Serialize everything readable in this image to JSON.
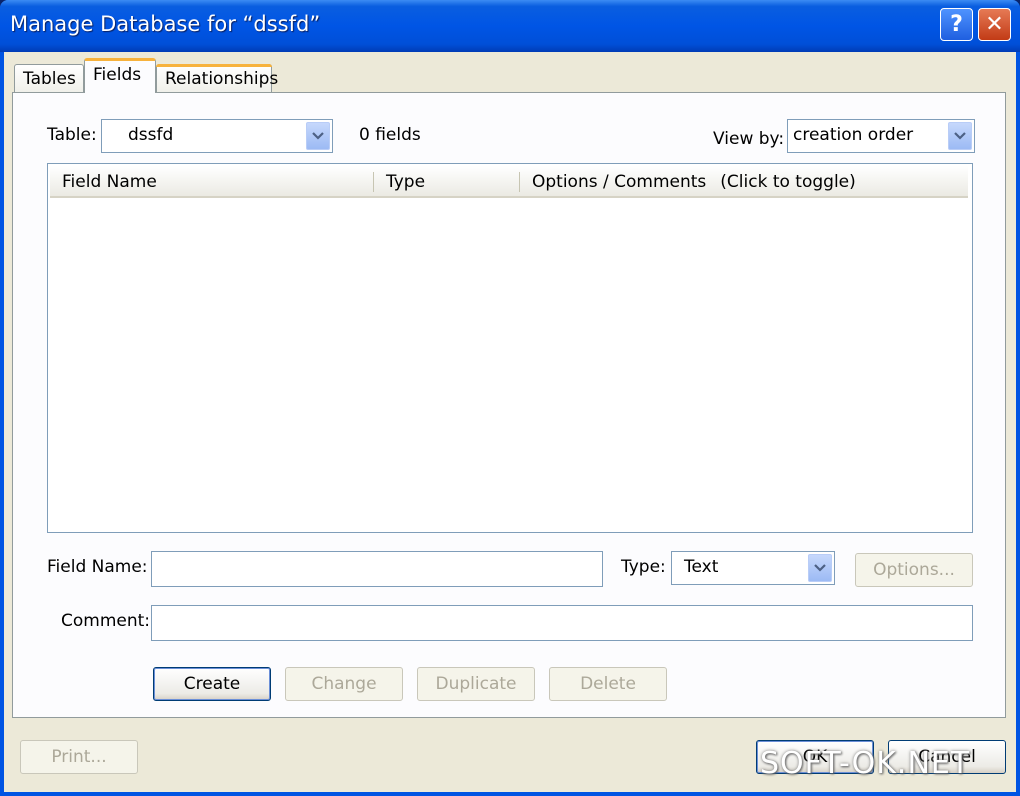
{
  "window": {
    "title": "Manage Database for “dssfd”",
    "help_glyph": "?",
    "close_glyph": "✕"
  },
  "tabs": [
    {
      "label": "Tables"
    },
    {
      "label": "Fields"
    },
    {
      "label": "Relationships"
    }
  ],
  "table_selector": {
    "label": "Table:",
    "value": "dssfd",
    "field_count": "0 fields"
  },
  "view_by": {
    "label": "View by:",
    "value": "creation order"
  },
  "list": {
    "columns": [
      "Field Name",
      "Type",
      "Options / Comments"
    ],
    "toggle_hint": "(Click to toggle)"
  },
  "field_form": {
    "field_name_label": "Field Name:",
    "field_name_value": "",
    "type_label": "Type:",
    "type_value": "Text",
    "options_button": "Options...",
    "comment_label": "Comment:",
    "comment_value": ""
  },
  "actions": {
    "create": "Create",
    "change": "Change",
    "duplicate": "Duplicate",
    "delete": "Delete"
  },
  "footer": {
    "print": "Print...",
    "ok": "OK",
    "cancel": "Cancel"
  },
  "watermark": "SOFT-OK.NET",
  "colors": {
    "titlebar": "#0055e5",
    "dialog_bg": "#ece9d8",
    "tab_highlight": "#f7b23c"
  }
}
